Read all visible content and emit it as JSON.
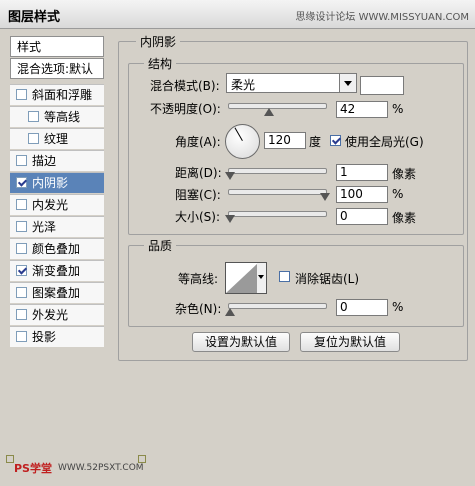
{
  "window": {
    "title": "图层样式",
    "watermark": "思缘设计论坛  WWW.MISSYUAN.COM"
  },
  "sidebar": {
    "header": "样式",
    "blend_options": "混合选项:默认",
    "items": [
      {
        "label": "斜面和浮雕",
        "checked": false
      },
      {
        "label": "等高线",
        "checked": false
      },
      {
        "label": "纹理",
        "checked": false
      },
      {
        "label": "描边",
        "checked": false
      },
      {
        "label": "内阴影",
        "checked": true
      },
      {
        "label": "内发光",
        "checked": false
      },
      {
        "label": "光泽",
        "checked": false
      },
      {
        "label": "颜色叠加",
        "checked": false
      },
      {
        "label": "渐变叠加",
        "checked": true
      },
      {
        "label": "图案叠加",
        "checked": false
      },
      {
        "label": "外发光",
        "checked": false
      },
      {
        "label": "投影",
        "checked": false
      }
    ]
  },
  "inner_shadow": {
    "title": "内阴影",
    "structure": {
      "title": "结构",
      "blend_mode_label": "混合模式(B):",
      "blend_mode_value": "柔光",
      "opacity_label": "不透明度(O):",
      "opacity_value": "42",
      "opacity_unit": "%",
      "angle_label": "角度(A):",
      "angle_value": "120",
      "angle_unit": "度",
      "global_light_label": "使用全局光(G)",
      "global_light_checked": true,
      "distance_label": "距离(D):",
      "distance_value": "1",
      "distance_unit": "像素",
      "choke_label": "阻塞(C):",
      "choke_value": "100",
      "choke_unit": "%",
      "size_label": "大小(S):",
      "size_value": "0",
      "size_unit": "像素"
    },
    "quality": {
      "title": "品质",
      "contour_label": "等高线:",
      "antialias_label": "消除锯齿(L)",
      "antialias_checked": false,
      "noise_label": "杂色(N):",
      "noise_value": "0",
      "noise_unit": "%"
    },
    "buttons": {
      "set_default": "设置为默认值",
      "reset_default": "复位为默认值"
    }
  },
  "footer": {
    "logo": "PS学堂",
    "url": "WWW.52PSXT.COM"
  }
}
